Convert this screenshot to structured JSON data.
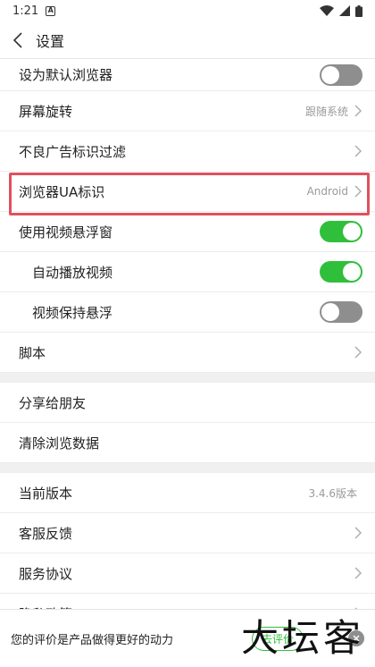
{
  "status": {
    "time": "1:21",
    "badge": "A"
  },
  "header": {
    "title": "设置"
  },
  "rows": [
    {
      "label": "设为默认浏览器",
      "toggle": "off"
    },
    {
      "label": "屏幕旋转",
      "value": "跟随系统"
    },
    {
      "label": "不良广告标识过滤"
    },
    {
      "label": "浏览器UA标识",
      "value": "Android"
    },
    {
      "label": "使用视频悬浮窗",
      "toggle": "on"
    },
    {
      "label": "自动播放视频",
      "toggle": "on"
    },
    {
      "label": "视频保持悬浮",
      "toggle": "off"
    },
    {
      "label": "脚本"
    },
    {
      "label": "分享给朋友"
    },
    {
      "label": "清除浏览数据"
    },
    {
      "label": "当前版本",
      "value": "3.4.6版本"
    },
    {
      "label": "客服反馈"
    },
    {
      "label": "服务协议"
    },
    {
      "label": "隐私政策"
    }
  ],
  "bottom": {
    "message": "您的评价是产品做得更好的动力",
    "rate_button": "去评价"
  },
  "watermark": "大坛客",
  "colors": {
    "toggle_on": "#2fbf3b",
    "toggle_off": "#8e8e8e",
    "highlight": "#e0515e"
  }
}
